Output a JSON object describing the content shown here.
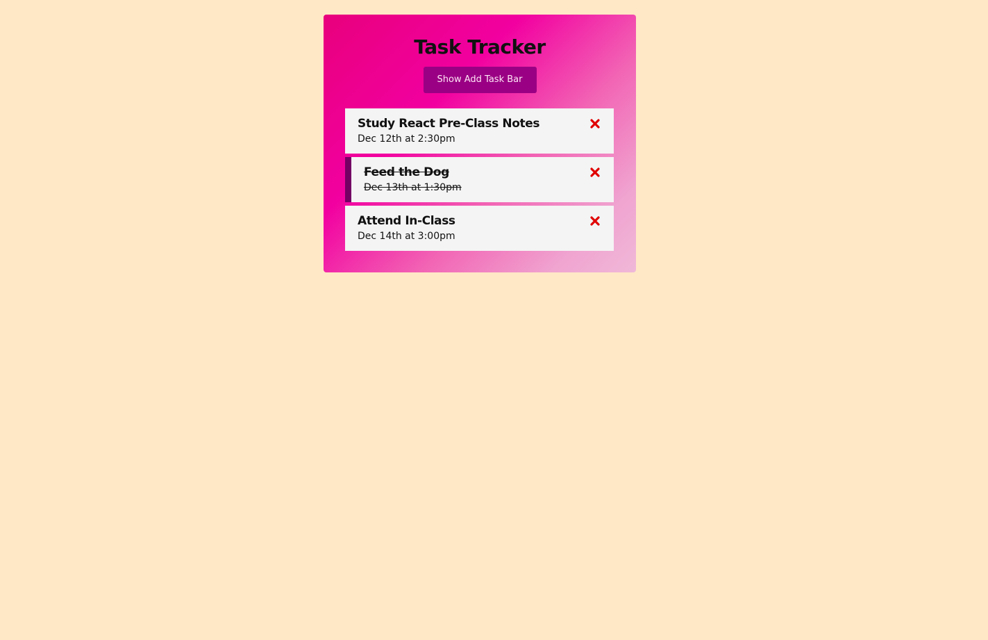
{
  "app": {
    "title": "Task Tracker",
    "toggle_button_label": "Show Add Task Bar"
  },
  "tasks": [
    {
      "text": "Study React Pre-Class Notes",
      "day": "Dec 12th at 2:30pm",
      "reminder": false
    },
    {
      "text": "Feed the Dog",
      "day": "Dec 13th at 1:30pm",
      "reminder": true
    },
    {
      "text": "Attend In-Class",
      "day": "Dec 14th at 3:00pm",
      "reminder": false
    }
  ],
  "colors": {
    "page_background": "#ffe8c6",
    "button_background": "#9a0084",
    "reminder_border": "#740064",
    "delete_icon": "#e00000"
  },
  "icons": {
    "delete": "close-icon"
  }
}
